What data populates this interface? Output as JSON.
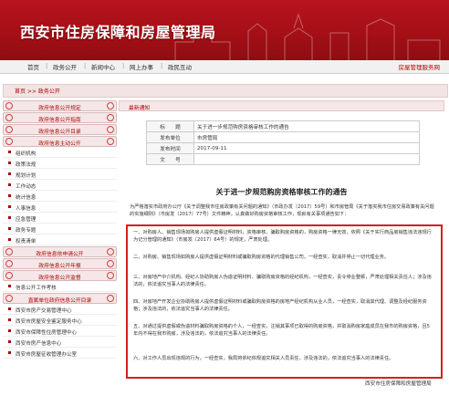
{
  "header": {
    "title": "西安市住房保障和房屋管理局"
  },
  "nav": {
    "items": [
      "首页",
      "政务公开",
      "新闻中心",
      "网上办事",
      "政民互动"
    ],
    "right": "房屋管理服务网"
  },
  "breadcrumb": "首页 >> 政务公开",
  "sidebar": {
    "items": [
      {
        "type": "head",
        "label": "政府信息公开规定"
      },
      {
        "type": "head",
        "label": "政府信息公开指南"
      },
      {
        "type": "head",
        "label": "政府信息公开目录"
      },
      {
        "type": "head",
        "label": "政府信息主动公开"
      },
      {
        "type": "sub",
        "label": "组织机构"
      },
      {
        "type": "sub",
        "label": "政策法规"
      },
      {
        "type": "sub",
        "label": "规划计划"
      },
      {
        "type": "sub",
        "label": "工作动态"
      },
      {
        "type": "sub",
        "label": "统计信息"
      },
      {
        "type": "sub",
        "label": "人事信息"
      },
      {
        "type": "sub",
        "label": "应急管理"
      },
      {
        "type": "sub",
        "label": "政务专题"
      },
      {
        "type": "sub",
        "label": "权责清单"
      },
      {
        "type": "head",
        "label": "政府信息依申请公开"
      },
      {
        "type": "head",
        "label": "政府信息公开年报"
      },
      {
        "type": "head",
        "label": "政府信息公开监督"
      },
      {
        "type": "sub",
        "label": "信息公开工作考核"
      },
      {
        "type": "head",
        "label": "直属单位政府信息公开目录"
      },
      {
        "type": "sub",
        "label": "西安市房产交易管理中心"
      },
      {
        "type": "sub",
        "label": "西安市房屋安全鉴定服务中心"
      },
      {
        "type": "sub",
        "label": "西安市保障性住房管理中心"
      },
      {
        "type": "sub",
        "label": "西安市房产信息中心"
      },
      {
        "type": "sub",
        "label": "西安市房屋征收管理办公室"
      }
    ]
  },
  "main": {
    "section_title": "最新通知",
    "meta": [
      {
        "key": "标　　题",
        "value": "关于进一步规范购房资格审核工作的通告"
      },
      {
        "key": "发布单位",
        "value": "市房管局"
      },
      {
        "key": "发布时间",
        "value": "2017-09-11"
      },
      {
        "key": "文　　号",
        "value": ""
      }
    ],
    "article_title": "关于进一步规范购房资格审核工作的通告",
    "intro": "为严格落实市政府办公厅《关于调整我市住房政策有关问题的通知》（市政办发〔2017〕59号）和市房管局《关于落实我市住房交易政策有关问题的实施细则》（市房发〔2017〕77号）文件精神，认真做好购房资格审核工作，现就有关事项通告如下：",
    "paragraphs": [
      "一、对购房人、销售现场如购房人提供虚假证明材料，资格审核、骗取购房资格的，购房资格一律无效，依照《关于实行商品房销售违法违规行为记分管理的通知》（市房发〔2017〕64号）的规定，严肃处理。",
      "二、对购房、销售现场如购房人提供虚假证明材料或骗取购房资格的代理销售公司，一经查实，取消并停止一切代理业务。",
      "三、对房地产中介机构、经纪人协助购房人伪造证明材料、骗取购房资格的经纪机构，一经查实，责令停业整顿，严肃处理相关责任人；涉及违法的，依法追究当事人的法律责任。",
      "四、对房地产开发企业协助购房人提供虚假证明材料或骗取购房资格的房地产经纪机构从业人员，一经查实，取消其代理、调整及经纪服务资格；涉及违法的，依法追究当事人的法律责任。",
      "五、对通过提供虚假或伪造材料骗取购房资格的个人，一经查实，注销其事项已取得的购房资格，并取消购房家庭成员在我市的购房资格，且5年内不得在我市购房，涉及违法的，依法追究当事人的法律责任。",
      "六、对工作人员出现违规的行为，一经查实，我局将依纪依规追究相关人员责任，涉及违法的，依法追究当事人的法律责任。"
    ],
    "signature": "西安市住房保障和房屋管理局"
  },
  "colors": {
    "brand_red": "#a50f16",
    "highlight_box": "#d42020"
  }
}
